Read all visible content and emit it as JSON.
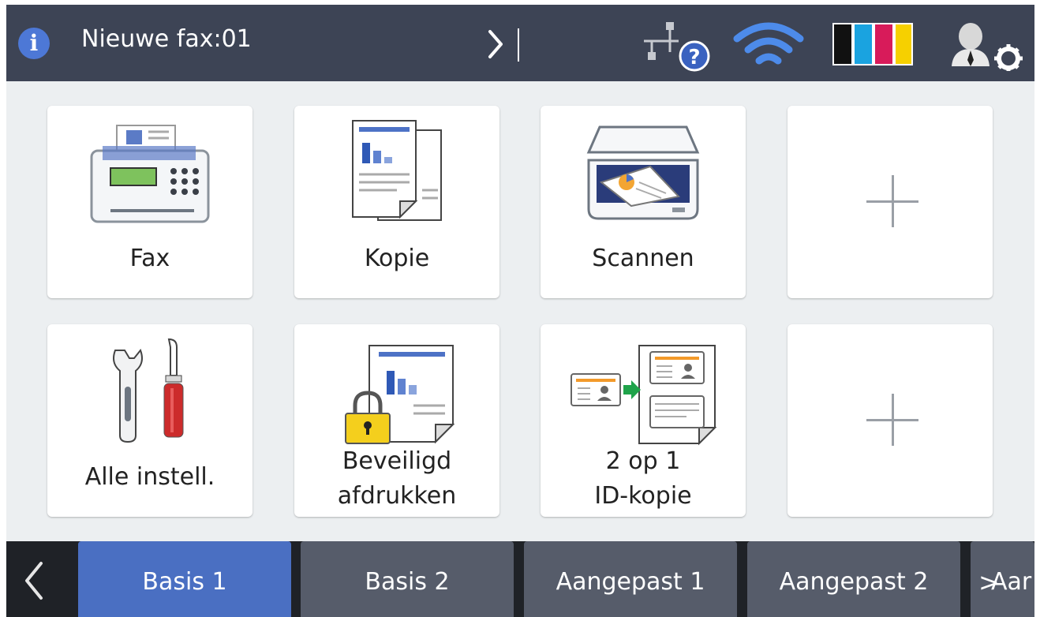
{
  "status_bar": {
    "info_icon": "info-icon",
    "info_glyph": "i",
    "fax_message": "Nieuwe fax:01",
    "icons": [
      "wired-network-unknown-icon",
      "wifi-icon",
      "ink-levels-icon",
      "admin-settings-icon"
    ],
    "network_badge": "?",
    "ink_colors": [
      "#111111",
      "#1aa3e0",
      "#d81b5a",
      "#f6d000"
    ]
  },
  "tiles": [
    {
      "label": "Fax",
      "icon": "fax-icon"
    },
    {
      "label": "Kopie",
      "icon": "copy-icon"
    },
    {
      "label": "Scannen",
      "icon": "scanner-icon"
    },
    {
      "label": "",
      "icon": "plus-icon"
    },
    {
      "label": "Alle instell.",
      "icon": "tools-icon"
    },
    {
      "label_line1": "Beveiligd",
      "label_line2": "afdrukken",
      "icon": "secure-print-icon"
    },
    {
      "label_line1": "2 op 1",
      "label_line2": "ID-kopie",
      "icon": "id-copy-icon"
    },
    {
      "label": "",
      "icon": "plus-icon"
    }
  ],
  "tabs": {
    "items": [
      "Basis 1",
      "Basis 2",
      "Aangepast 1",
      "Aangepast 2"
    ],
    "partial": "Aar",
    "active": "Basis 1"
  },
  "colors": {
    "status_bar": "#3d4455",
    "accent": "#4a6fc2",
    "tab_inactive": "#565c6a"
  }
}
